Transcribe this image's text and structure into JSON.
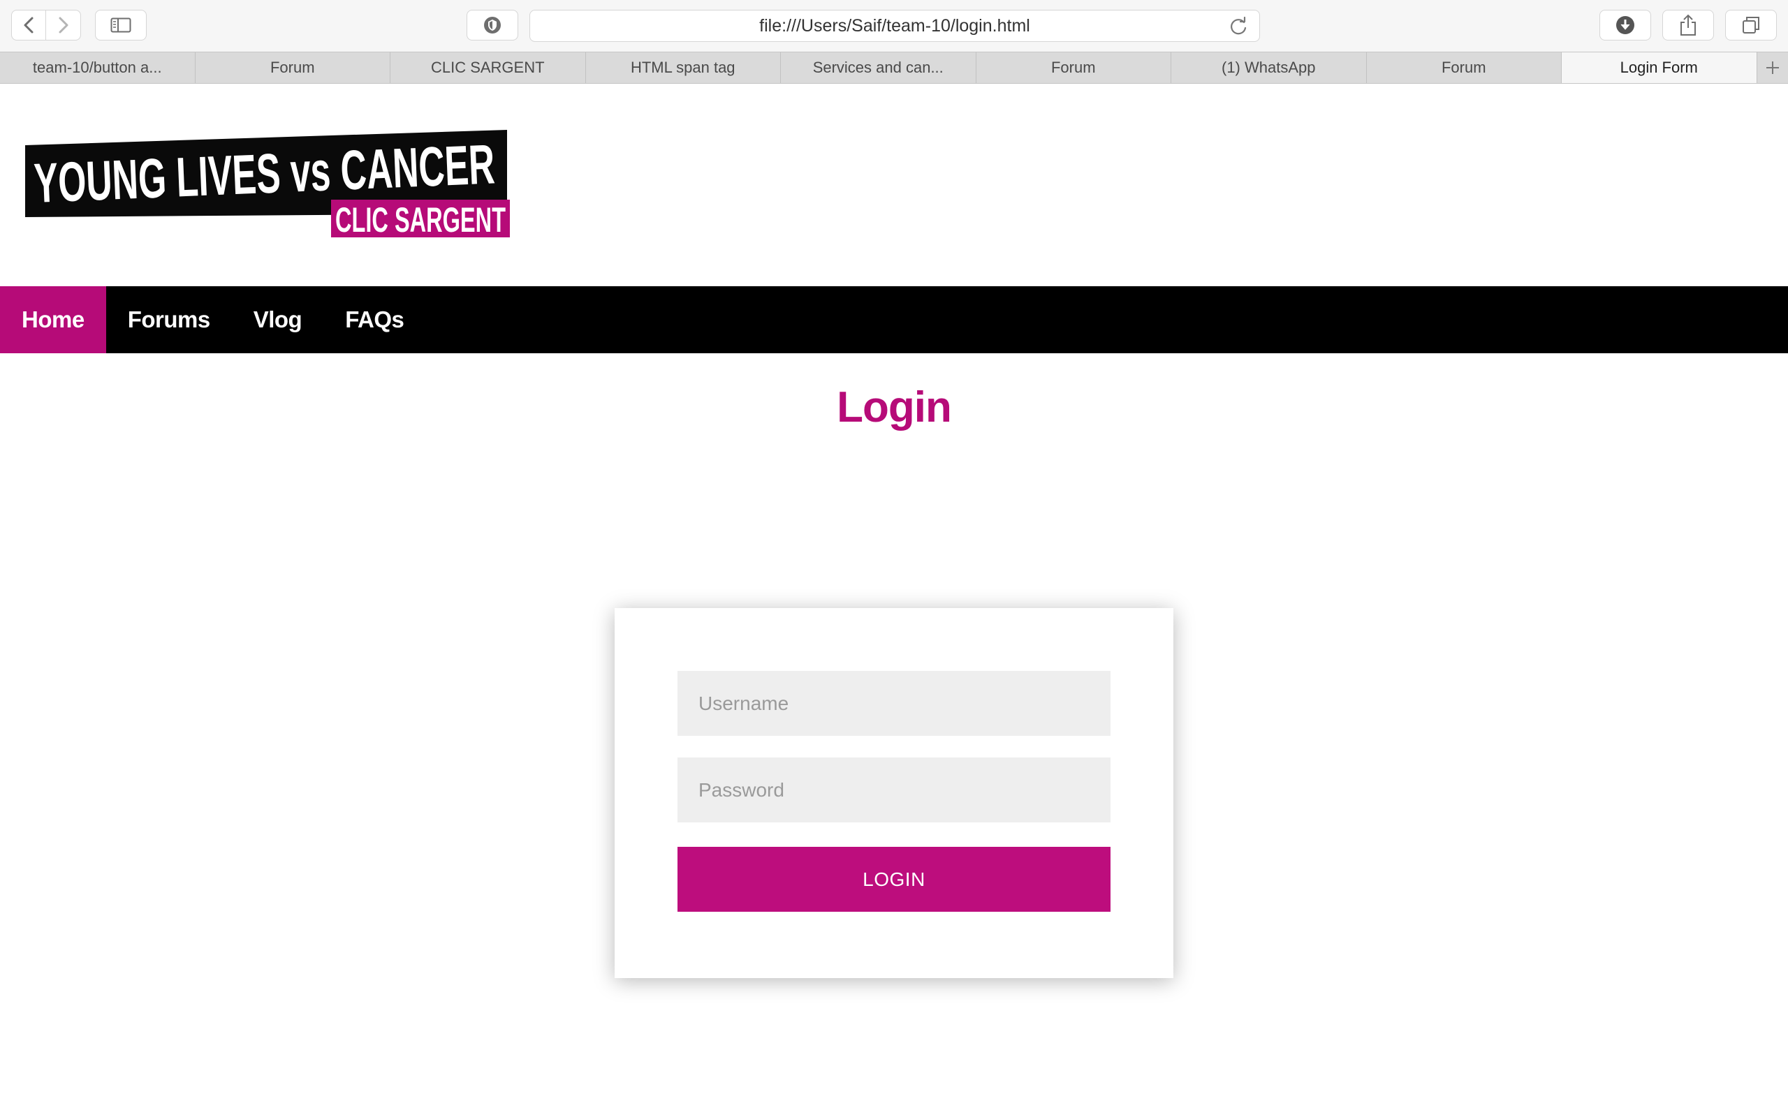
{
  "browser": {
    "address": "file:///Users/Saif/team-10/login.html",
    "tabs": [
      {
        "label": "team-10/button a..."
      },
      {
        "label": "Forum"
      },
      {
        "label": "CLIC SARGENT"
      },
      {
        "label": "HTML span tag"
      },
      {
        "label": "Services and can..."
      },
      {
        "label": "Forum"
      },
      {
        "label": "(1) WhatsApp"
      },
      {
        "label": "Forum"
      },
      {
        "label": "Login Form"
      }
    ],
    "active_tab_index": 8
  },
  "logo": {
    "line1": "YOUNG LIVES vs CANCER",
    "line2": "CLIC SARGENT"
  },
  "navbar": {
    "items": [
      {
        "label": "Home"
      },
      {
        "label": "Forums"
      },
      {
        "label": "Vlog"
      },
      {
        "label": "FAQs"
      }
    ],
    "active_index": 0
  },
  "page": {
    "title": "Login"
  },
  "form": {
    "username_placeholder": "Username",
    "password_placeholder": "Password",
    "submit_label": "LOGIN"
  },
  "colors": {
    "brand": "#b60b78",
    "navbar_bg": "#000000",
    "field_bg": "#eeeeee"
  },
  "icons": {
    "back": "chevron-left-icon",
    "forward": "chevron-right-icon",
    "sidebar": "sidebar-icon",
    "shield": "shield-icon",
    "reload": "reload-icon",
    "download": "download-icon",
    "share": "share-icon",
    "tabs": "tabs-overview-icon",
    "new_tab": "plus-icon"
  }
}
